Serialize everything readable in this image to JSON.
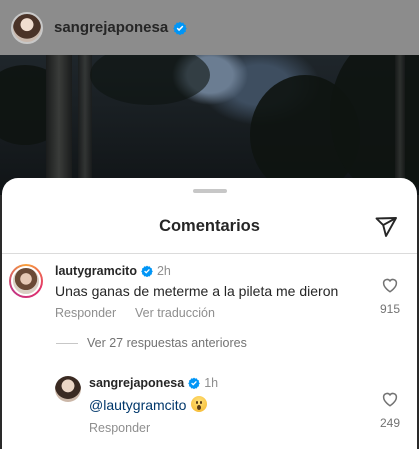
{
  "post": {
    "username": "sangrejaponesa"
  },
  "sheet": {
    "title": "Comentarios"
  },
  "comment": {
    "username": "lautygramcito",
    "time": "2h",
    "text": "Unas ganas de meterme a la pileta me dieron",
    "reply_action": "Responder",
    "translate_action": "Ver traducción",
    "likes": "915",
    "previous_replies": "Ver 27 respuestas anteriores"
  },
  "reply": {
    "username": "sangrejaponesa",
    "time": "1h",
    "mention": "@lautygramcito",
    "emoji": "astonished-face",
    "reply_action": "Responder",
    "likes": "249"
  },
  "colors": {
    "verified": "#0095f6",
    "mention": "#00376b",
    "secondary_text": "#8e8e8e"
  }
}
